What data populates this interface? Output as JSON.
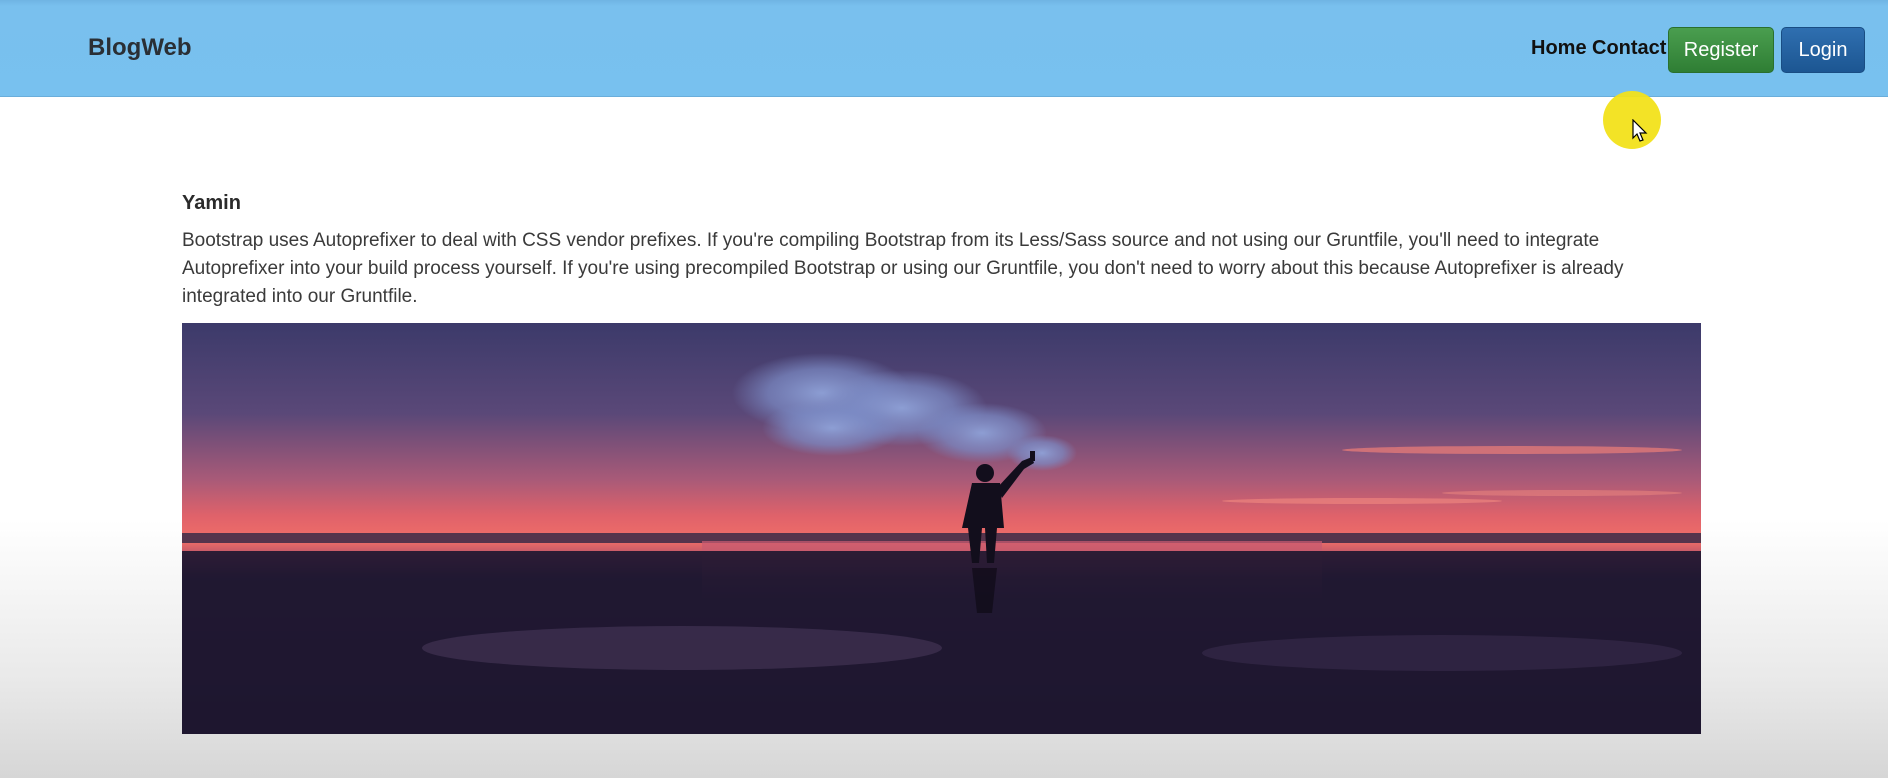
{
  "navbar": {
    "brand": "BlogWeb",
    "links": [
      "Home",
      "Contact"
    ],
    "register_label": "Register",
    "login_label": "Login",
    "colors": {
      "bar": "#78c1ef",
      "register": "#35863a",
      "login": "#215e9c"
    }
  },
  "post": {
    "author": "Yamin",
    "body": "Bootstrap uses Autoprefixer to deal with CSS vendor prefixes. If you're compiling Bootstrap from its Less/Sass source and not using our Gruntfile, you'll need to integrate Autoprefixer into your build process yourself. If you're using precompiled Bootstrap or using our Gruntfile, you don't need to worry about this because Autoprefixer is already integrated into our Gruntfile.",
    "image_icon": "sunset-smoke-silhouette-image"
  },
  "cursor": {
    "icon": "mouse-pointer-icon",
    "highlight_color": "#f2e21a"
  }
}
